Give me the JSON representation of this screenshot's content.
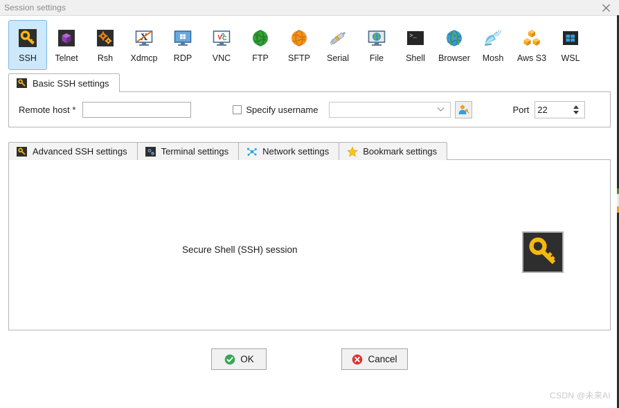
{
  "window": {
    "title": "Session settings",
    "close_label": "✕"
  },
  "protocols": [
    {
      "id": "ssh",
      "label": "SSH",
      "icon": "key-icon",
      "selected": true
    },
    {
      "id": "telnet",
      "label": "Telnet",
      "icon": "purple-cube-icon",
      "selected": false
    },
    {
      "id": "rsh",
      "label": "Rsh",
      "icon": "orange-gears-icon",
      "selected": false
    },
    {
      "id": "xdmcp",
      "label": "Xdmcp",
      "icon": "x-monitor-icon",
      "selected": false
    },
    {
      "id": "rdp",
      "label": "RDP",
      "icon": "windows-monitor-icon",
      "selected": false
    },
    {
      "id": "vnc",
      "label": "VNC",
      "icon": "vnc-monitor-icon",
      "selected": false
    },
    {
      "id": "ftp",
      "label": "FTP",
      "icon": "green-globe-icon",
      "selected": false
    },
    {
      "id": "sftp",
      "label": "SFTP",
      "icon": "orange-globe-icon",
      "selected": false
    },
    {
      "id": "serial",
      "label": "Serial",
      "icon": "plug-connector-icon",
      "selected": false
    },
    {
      "id": "file",
      "label": "File",
      "icon": "globe-monitor-icon",
      "selected": false
    },
    {
      "id": "shell",
      "label": "Shell",
      "icon": "terminal-prompt-icon",
      "selected": false
    },
    {
      "id": "browser",
      "label": "Browser",
      "icon": "blue-globe-icon",
      "selected": false
    },
    {
      "id": "mosh",
      "label": "Mosh",
      "icon": "satellite-dish-icon",
      "selected": false
    },
    {
      "id": "awss3",
      "label": "Aws S3",
      "icon": "aws-cubes-icon",
      "selected": false
    },
    {
      "id": "wsl",
      "label": "WSL",
      "icon": "windows-logo-icon",
      "selected": false
    }
  ],
  "basic_tab": {
    "label": "Basic SSH settings",
    "icon": "key-icon"
  },
  "basic_form": {
    "remote_host_label": "Remote host *",
    "remote_host_value": "",
    "remote_host_placeholder": "",
    "specify_username_label": "Specify username",
    "specify_username_checked": false,
    "username_value": "",
    "username_placeholder": "",
    "user_button_icon": "user-key-icon",
    "port_label": "Port",
    "port_value": "22"
  },
  "settings_tabs": [
    {
      "id": "advanced-ssh",
      "label": "Advanced SSH settings",
      "icon": "key-icon",
      "active": false
    },
    {
      "id": "terminal",
      "label": "Terminal settings",
      "icon": "gears-icon",
      "active": false
    },
    {
      "id": "network",
      "label": "Network settings",
      "icon": "network-icon",
      "active": false
    },
    {
      "id": "bookmark",
      "label": "Bookmark settings",
      "icon": "star-icon",
      "active": false
    }
  ],
  "content": {
    "session_description": "Secure Shell (SSH) session",
    "big_icon": "key-icon"
  },
  "footer": {
    "ok_label": "OK",
    "ok_icon": "green-check-icon",
    "cancel_label": "Cancel",
    "cancel_icon": "red-x-icon"
  },
  "watermark": "CSDN @未来AI",
  "colors": {
    "selected_tab_bg": "#cde8fa",
    "selected_tab_border": "#7cb8e2",
    "key_yellow": "#f5b810",
    "icon_dark_bg": "#2e2e2e",
    "ok_green": "#34a853",
    "cancel_red": "#e03131",
    "panel_border": "#b4b4b4"
  }
}
